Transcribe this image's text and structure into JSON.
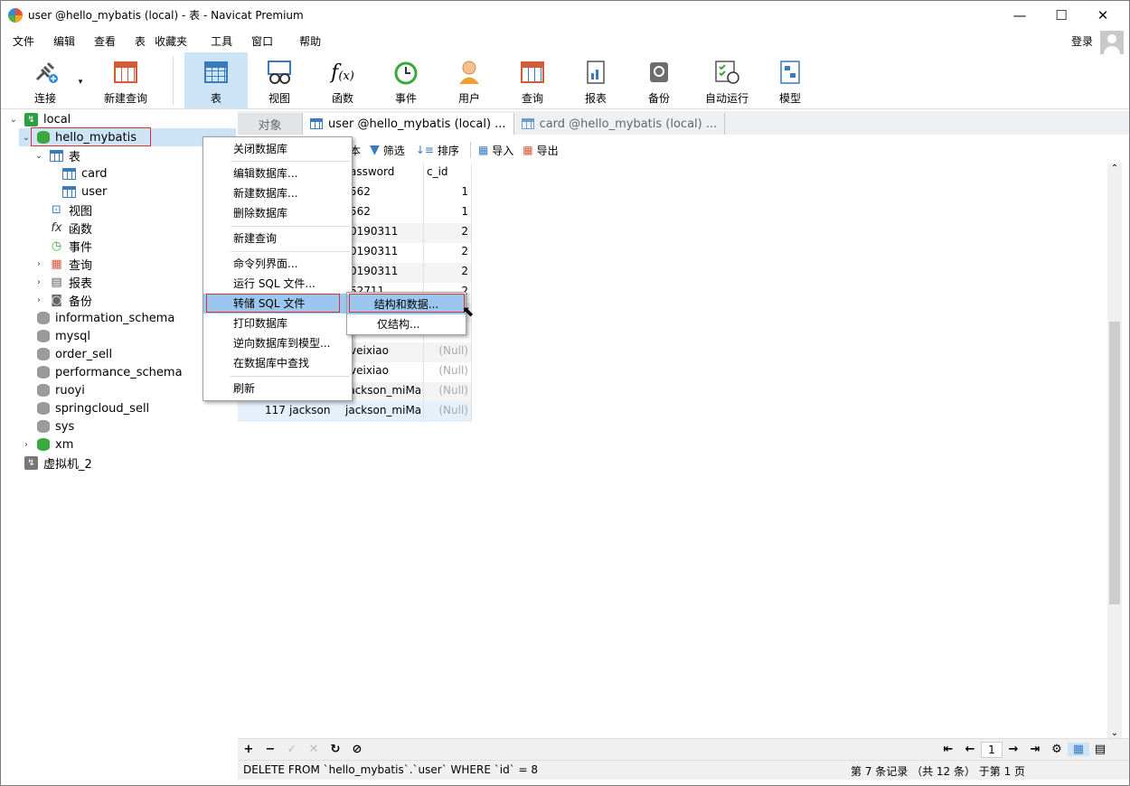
{
  "window": {
    "title": "user @hello_mybatis (local) - 表 - Navicat Premium",
    "minimize": "—",
    "maximize": "☐",
    "close": "✕"
  },
  "menu": [
    "文件",
    "编辑",
    "查看",
    "表",
    "收藏夹",
    "工具",
    "窗口",
    "帮助"
  ],
  "login_label": "登录",
  "toolbar": [
    {
      "label": "连接",
      "icon": "plug-connect-icon"
    },
    {
      "label": "新建查询",
      "icon": "new-query-icon"
    },
    {
      "label": "表",
      "icon": "table-icon",
      "active": true
    },
    {
      "label": "视图",
      "icon": "view-glasses-icon"
    },
    {
      "label": "函数",
      "icon": "function-fx-icon"
    },
    {
      "label": "事件",
      "icon": "clock-event-icon"
    },
    {
      "label": "用户",
      "icon": "user-icon"
    },
    {
      "label": "查询",
      "icon": "query-grid-icon"
    },
    {
      "label": "报表",
      "icon": "report-icon"
    },
    {
      "label": "备份",
      "icon": "backup-icon"
    },
    {
      "label": "自动运行",
      "icon": "auto-run-icon"
    },
    {
      "label": "模型",
      "icon": "model-icon"
    }
  ],
  "tree": {
    "connection": "local",
    "database": "hello_mybatis",
    "tables_group": "表",
    "tables": [
      "card",
      "user"
    ],
    "groups": [
      "视图",
      "函数",
      "事件",
      "查询",
      "报表",
      "备份"
    ],
    "other_databases": [
      "information_schema",
      "mysql",
      "order_sell",
      "performance_schema",
      "ruoyi",
      "springcloud_sell",
      "sys",
      "xm"
    ],
    "other_connection": "虚拟机_2"
  },
  "tabs": {
    "objects": "对象",
    "tab1": "user @hello_mybatis (local) ...",
    "tab2": "card @hello_mybatis (local) ..."
  },
  "subtoolbar": {
    "text_partial": "本",
    "filter": "筛选",
    "sort": "排序",
    "import": "导入",
    "export": "导出"
  },
  "grid": {
    "columns": [
      "assword",
      "c_id"
    ],
    "rows": [
      {
        "pwd": "562",
        "cid": "1"
      },
      {
        "pwd": "562",
        "cid": "1"
      },
      {
        "pwd": "0190311",
        "cid": "2"
      },
      {
        "pwd": "0190311",
        "cid": "2"
      },
      {
        "pwd": "0190311",
        "cid": "2"
      },
      {
        "pwd": "52711",
        "cid": "2"
      },
      {
        "pwd": "",
        "cid": ""
      },
      {
        "pwd": "veixiao",
        "cid": "(Null)"
      },
      {
        "pwd": "veixiao",
        "cid": "(Null)"
      },
      {
        "pwd": "jackson_miMa",
        "cid": "(Null)"
      }
    ],
    "last_row": {
      "id": "117",
      "name": "jackson",
      "pwd": "jackson_miMa",
      "cid": "(Null)"
    }
  },
  "context_menu": {
    "items": [
      "关闭数据库",
      "编辑数据库...",
      "新建数据库...",
      "删除数据库",
      "新建查询",
      "命令列界面...",
      "运行 SQL 文件...",
      "转储 SQL 文件",
      "打印数据库",
      "逆向数据库到模型...",
      "在数据库中查找",
      "刷新"
    ],
    "submenu": [
      "结构和数据...",
      "仅结构..."
    ]
  },
  "pager": {
    "page": "1"
  },
  "status": {
    "sql": "DELETE FROM `hello_mybatis`.`user` WHERE `id` = 8",
    "record": "第 7 条记录 （共 12 条） 于第 1 页"
  },
  "colors": {
    "accent": "#cde4f7",
    "highlight_box": "#e03030",
    "menu_selected": "#9bc7ef"
  }
}
